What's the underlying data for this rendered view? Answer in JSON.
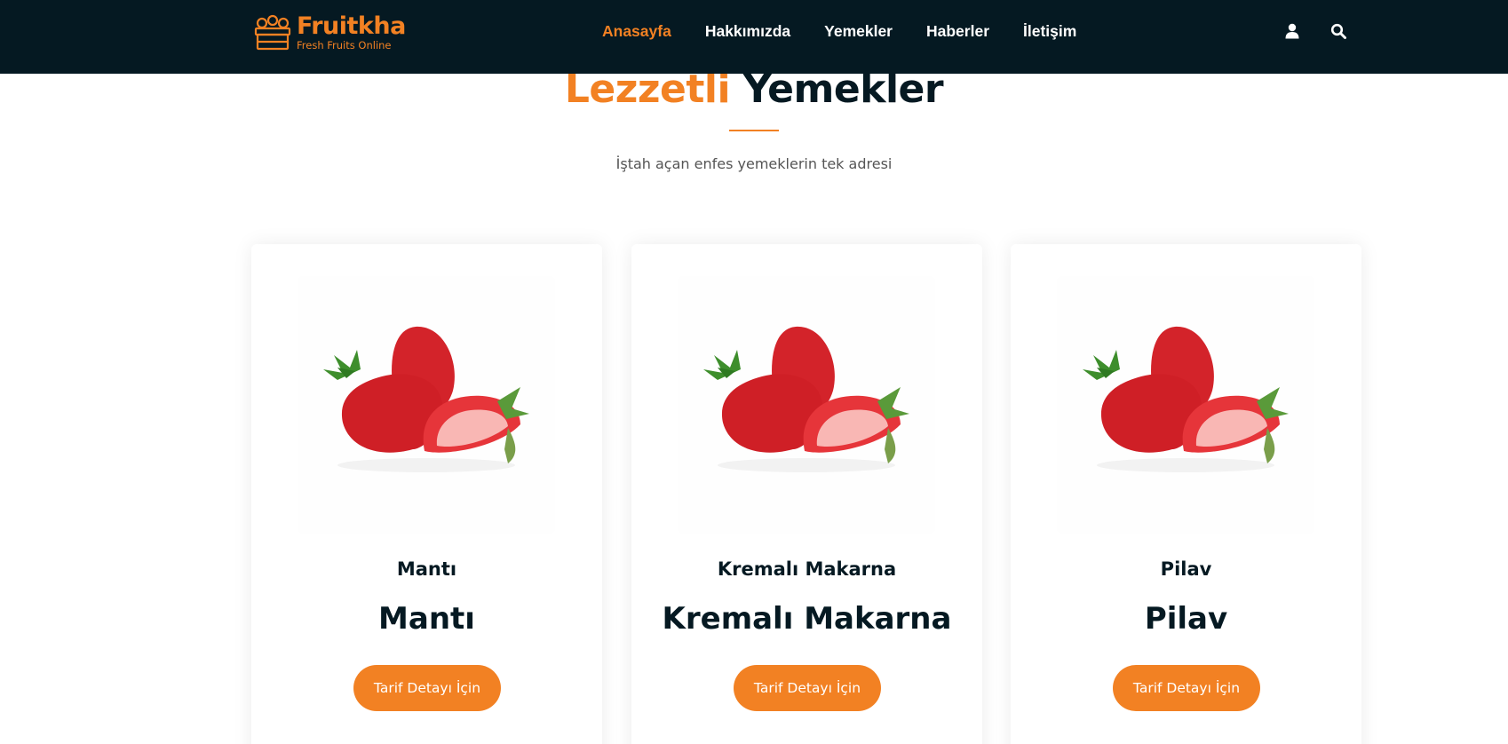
{
  "brand": {
    "name": "Fruitkha",
    "tagline": "Fresh Fruits Online",
    "accent": "#f28123",
    "dark": "#051922"
  },
  "nav": {
    "items": [
      {
        "label": "Anasayfa",
        "active": true
      },
      {
        "label": "Hakkımızda",
        "active": false
      },
      {
        "label": "Yemekler",
        "active": false
      },
      {
        "label": "Haberler",
        "active": false
      },
      {
        "label": "İletişim",
        "active": false
      }
    ],
    "icons": [
      "user-icon",
      "search-icon"
    ]
  },
  "section": {
    "title_highlight": "Lezzetli",
    "title_rest": "Yemekler",
    "subtitle": "İştah açan enfes yemeklerin tek adresi"
  },
  "cards": [
    {
      "subtitle": "Mantı",
      "title": "Mantı",
      "button": "Tarif Detayı İçin",
      "image": "strawberries-image"
    },
    {
      "subtitle": "Kremalı Makarna",
      "title": "Kremalı Makarna",
      "button": "Tarif Detayı İçin",
      "image": "strawberries-image"
    },
    {
      "subtitle": "Pilav",
      "title": "Pilav",
      "button": "Tarif Detayı İçin",
      "image": "strawberries-image"
    }
  ]
}
